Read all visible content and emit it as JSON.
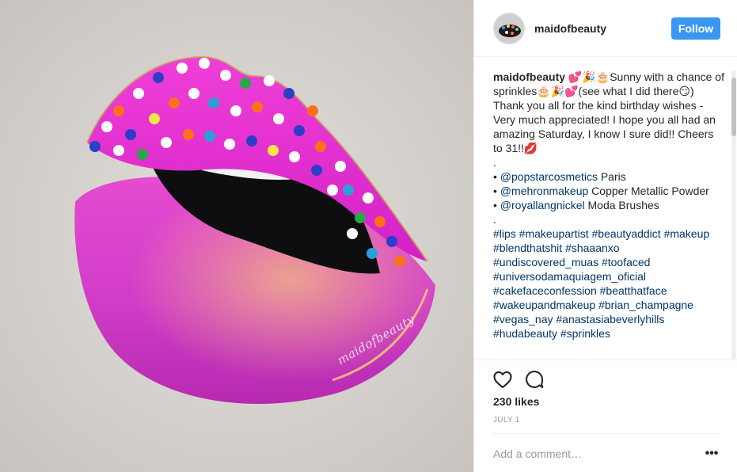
{
  "post": {
    "username": "maidofbeauty",
    "follow_label": "Follow",
    "watermark": "maidofbeauty"
  },
  "caption": {
    "username": "maidofbeauty",
    "line1": " 💕🎉🎂Sunny with a chance of sprinkles🎂🎉💕(see what I did there😏) Thank you all for the kind birthday wishes - Very much appreciated! I hope you all had an amazing Saturday, I know I sure did!! Cheers to 31!!💋",
    "dot1": ".",
    "credits": [
      {
        "bullet": "• ",
        "mention": "@popstarcosmetics",
        "text": " Paris"
      },
      {
        "bullet": "• ",
        "mention": "@mehronmakeup",
        "text": " Copper Metallic Powder"
      },
      {
        "bullet": "• ",
        "mention": "@royallangnickel",
        "text": " Moda Brushes"
      }
    ],
    "dot2": ".",
    "hashtags": "#lips #makeupartist #beautyaddict #makeup #blendthatshit #shaaanxo #undiscovered_muas #toofaced #universodamaquiagem_oficial #cakefaceconfession #beatthatface #wakeupandmakeup #brian_champagne #vegas_nay #anastasiabeverlyhills #hudabeauty #sprinkles"
  },
  "actions": {
    "like_icon": "heart-outline-icon",
    "comment_icon": "comment-bubble-icon",
    "likes": "230 likes",
    "date": "JULY 1"
  },
  "comment": {
    "placeholder": "Add a comment…",
    "more_label": "•••"
  },
  "colors": {
    "accent": "#3897f0",
    "link": "#003569",
    "lip_pink": "#e01fc0"
  }
}
